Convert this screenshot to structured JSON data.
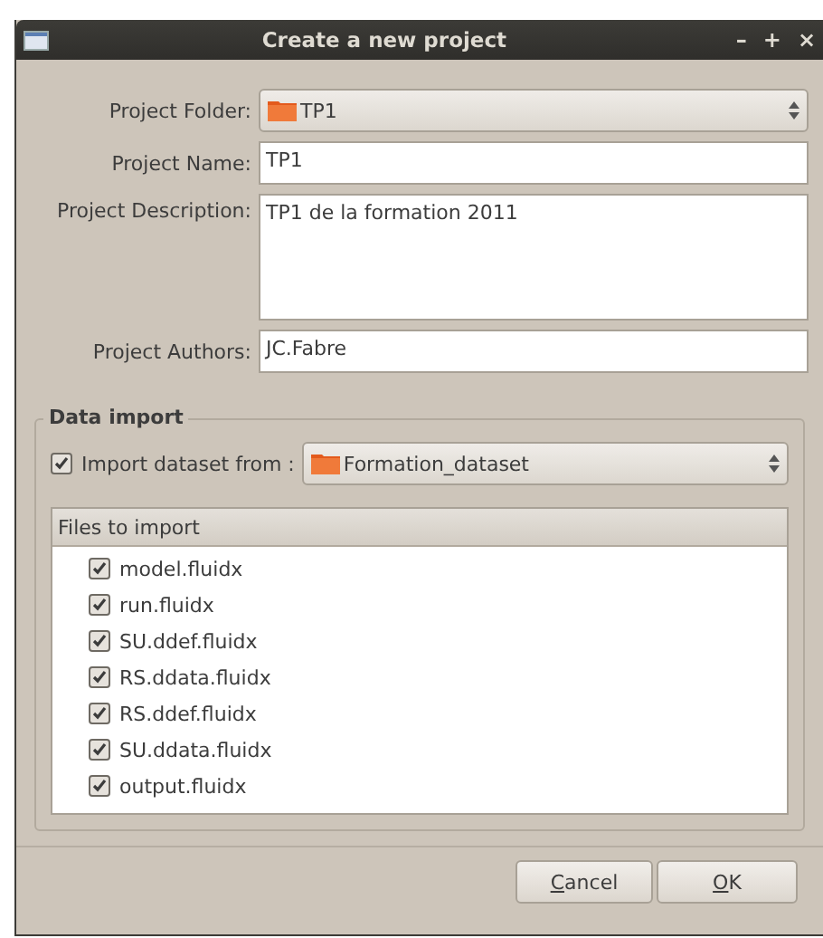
{
  "window": {
    "title": "Create a new project",
    "controls": [
      "–",
      "+",
      "×"
    ]
  },
  "form": [
    {
      "kind": "combo",
      "label": "Project Folder:",
      "value": "TP1"
    },
    {
      "kind": "line",
      "label": "Project Name:",
      "value": "TP1"
    },
    {
      "kind": "area",
      "label": "Project Description:",
      "value": "TP1 de la formation 2011"
    },
    {
      "kind": "line",
      "label": "Project Authors:",
      "value": "JC.Fabre"
    }
  ],
  "data_import": {
    "title": "Data import",
    "import_checkbox": {
      "label": "Import dataset from :",
      "checked": true
    },
    "dataset": "Formation_dataset",
    "files_header": "Files to import",
    "files": [
      {
        "name": "model.fluidx",
        "checked": true
      },
      {
        "name": "run.fluidx",
        "checked": true
      },
      {
        "name": "SU.ddef.fluidx",
        "checked": true
      },
      {
        "name": "RS.ddata.fluidx",
        "checked": true
      },
      {
        "name": "RS.ddef.fluidx",
        "checked": true
      },
      {
        "name": "SU.ddata.fluidx",
        "checked": true
      },
      {
        "name": "output.fluidx",
        "checked": true
      }
    ]
  },
  "buttons": [
    {
      "label": "Cancel",
      "first_letter_underlined": true
    },
    {
      "label": "OK",
      "first_letter_underlined": true
    }
  ]
}
